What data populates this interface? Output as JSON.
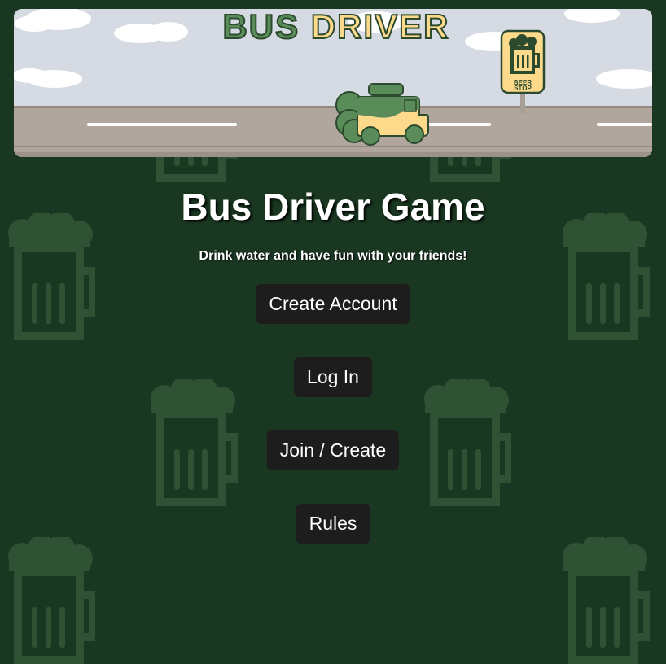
{
  "banner": {
    "logo_text": "BUS DRIVER",
    "sign_text_line1": "BEER",
    "sign_text_line2": "STOP"
  },
  "main": {
    "title": "Bus Driver Game",
    "tagline": "Drink water and have fun with your friends!"
  },
  "menu": {
    "create_account": "Create Account",
    "log_in": "Log In",
    "join_create": "Join / Create",
    "rules": "Rules"
  },
  "colors": {
    "background": "#193721",
    "pattern": "#2f5234",
    "button": "#1d1d1d",
    "bus_green": "#5a8c5a",
    "bus_yellow": "#fdd98c",
    "road": "#b0a69d",
    "sky": "#d6dbe3"
  }
}
